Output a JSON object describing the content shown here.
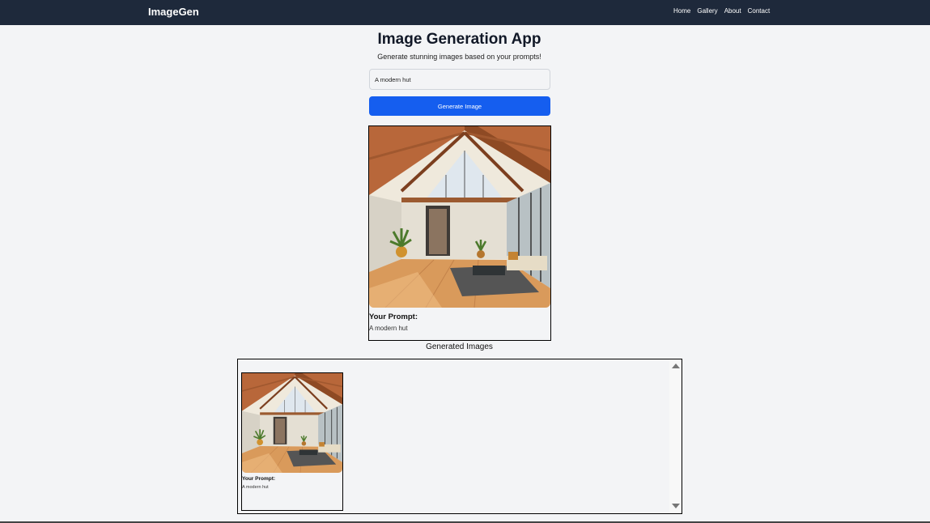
{
  "navbar": {
    "brand": "ImageGen",
    "links": [
      "Home",
      "Gallery",
      "About",
      "Contact"
    ]
  },
  "header": {
    "title": "Image Generation App",
    "subtitle": "Generate stunning images based on your prompts!"
  },
  "prompt_input": {
    "value": "A modern hut"
  },
  "generate_button": {
    "label": "Generate Image"
  },
  "result": {
    "prompt_label": "Your Prompt:",
    "prompt_text": "A modern hut"
  },
  "gallery": {
    "title": "Generated Images",
    "items": [
      {
        "prompt_label": "Your Prompt:",
        "prompt_text": "A modern hut"
      }
    ]
  },
  "colors": {
    "navbar": "#1e293b",
    "accent": "#155eef",
    "background": "#f3f4f6"
  }
}
